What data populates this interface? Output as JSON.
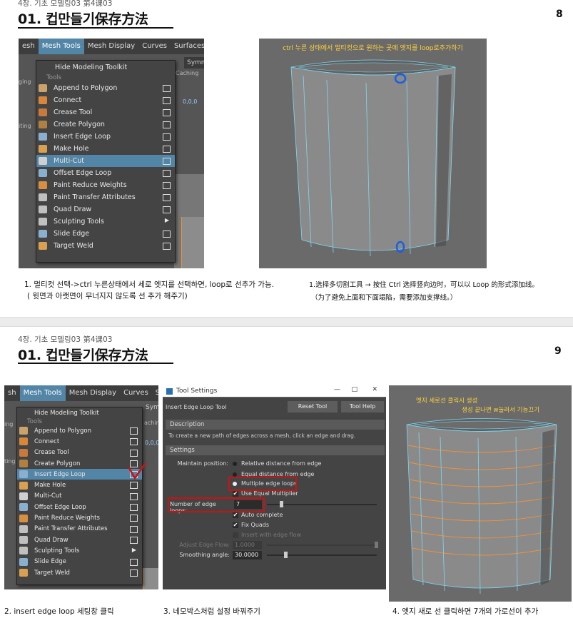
{
  "page8": {
    "chapter": "4장. 기초 모델링03 第4课03",
    "title": "01. 컵만들기保存方法",
    "page_number": "8",
    "menubar": [
      "esh",
      "Mesh Tools",
      "Mesh Display",
      "Curves",
      "Surfaces",
      "D"
    ],
    "symmetry_label": "Symme",
    "behind_labels": {
      "caching": "Caching",
      "ging": "ging",
      "iting": "iting",
      "coords": "0,0,0"
    },
    "menu": {
      "top_item": "Hide Modeling Toolkit",
      "section": "Tools",
      "items": [
        {
          "label": "Append to Polygon",
          "box": true
        },
        {
          "label": "Connect",
          "box": true
        },
        {
          "label": "Crease Tool",
          "box": true
        },
        {
          "label": "Create Polygon",
          "box": true
        },
        {
          "label": "Insert Edge Loop",
          "box": true
        },
        {
          "label": "Make Hole",
          "box": true
        },
        {
          "label": "Multi-Cut",
          "box": true,
          "highlighted": true
        },
        {
          "label": "Offset Edge Loop",
          "box": true
        },
        {
          "label": "Paint Reduce Weights",
          "box": true
        },
        {
          "label": "Paint Transfer Attributes",
          "box": true
        },
        {
          "label": "Quad Draw",
          "box": true
        },
        {
          "label": "Sculpting Tools",
          "submenu": true
        },
        {
          "label": "Slide Edge",
          "box": true
        },
        {
          "label": "Target Weld",
          "box": true
        }
      ]
    },
    "viewport_caption": "ctrl 누른 상태에서 멀티컷으로 원하는 곳에 엣지를 loop로추가하기",
    "caption_ko_1": "1.  멀티컷 선택->ctrl 누른상태에서 세로 엣지를 선택하면, loop로 선추가 가능.",
    "caption_ko_2": "( 윗면과 아랫면이 무너지지 않도록 선 추가 해주기)",
    "caption_cn_1": "1.选择多切割工具 → 按住 Ctrl 选择竖向边时，可以以 Loop 的形式添加线。",
    "caption_cn_2": "（为了避免上面和下面塌陷，需要添加支撑线。）"
  },
  "page9": {
    "chapter": "4장. 기초 모델링03 第4课03",
    "title": "01. 컵만들기保存方法",
    "page_number": "9",
    "menubar": [
      "sh",
      "Mesh Tools",
      "Mesh Display",
      "Curves",
      "Surfaces"
    ],
    "behind_labels": {
      "sym": "Sym",
      "cachin": "achin",
      "ing": "ing",
      "iting": "ting",
      "coords": "0,0,0"
    },
    "menu": {
      "top_item": "Hide Modeling Toolkit",
      "section": "Tools",
      "items": [
        {
          "label": "Append to Polygon",
          "box": true
        },
        {
          "label": "Connect",
          "box": true
        },
        {
          "label": "Crease Tool",
          "box": true
        },
        {
          "label": "Create Polygon",
          "box": true
        },
        {
          "label": "Insert Edge Loop",
          "box": true,
          "highlighted": true
        },
        {
          "label": "Make Hole",
          "box": true
        },
        {
          "label": "Multi-Cut",
          "box": true
        },
        {
          "label": "Offset Edge Loop",
          "box": true
        },
        {
          "label": "Paint Reduce Weights",
          "box": true
        },
        {
          "label": "Paint Transfer Attributes",
          "box": true
        },
        {
          "label": "Quad Draw",
          "box": true
        },
        {
          "label": "Sculpting Tools",
          "submenu": true
        },
        {
          "label": "Slide Edge",
          "box": true
        },
        {
          "label": "Target Weld",
          "box": true
        }
      ]
    },
    "tool_settings": {
      "window_title": "Tool Settings",
      "tool_name": "Insert Edge Loop Tool",
      "reset_button": "Reset Tool",
      "help_button": "Tool Help",
      "description_header": "Description",
      "description_text": "To create a new path of edges across a mesh, click an edge and drag.",
      "settings_header": "Settings",
      "maintain_position_label": "Maintain position:",
      "maintain_options": [
        "Relative distance from edge",
        "Equal distance from edge",
        "Multiple edge loops"
      ],
      "use_equal_multiplier": "Use Equal Multiplier",
      "number_of_edge_loops_label": "Number of edge loops:",
      "number_of_edge_loops_value": "7",
      "auto_complete": "Auto complete",
      "fix_quads": "Fix Quads",
      "insert_with_edge_flow": "Insert with edge flow",
      "adjust_edge_flow_label": "Adjust Edge Flow:",
      "adjust_edge_flow_value": "1.0000",
      "smoothing_angle_label": "Smoothing angle:",
      "smoothing_angle_value": "30.0000"
    },
    "viewport_caption_1": "엣지 세로선 클릭시 생성",
    "viewport_caption_2": "생성 끝나면 w눌러서 기능끄기",
    "caption_2": "2. insert edge loop  세팅창 클릭",
    "caption_3": "3. 네모박스처럼 설정 바꿔주기",
    "caption_4": "4. 엣지 새로 선 클릭하면 7개의 가로선이 추가"
  },
  "colors": {
    "highlight": "#5285a6",
    "annotation_red": "#d01010",
    "annotation_blue": "#1a5fe0",
    "mesh_edge": "#7fd8f0",
    "edge_loop": "#f0913a",
    "caption_yellow": "#ffd23c"
  }
}
